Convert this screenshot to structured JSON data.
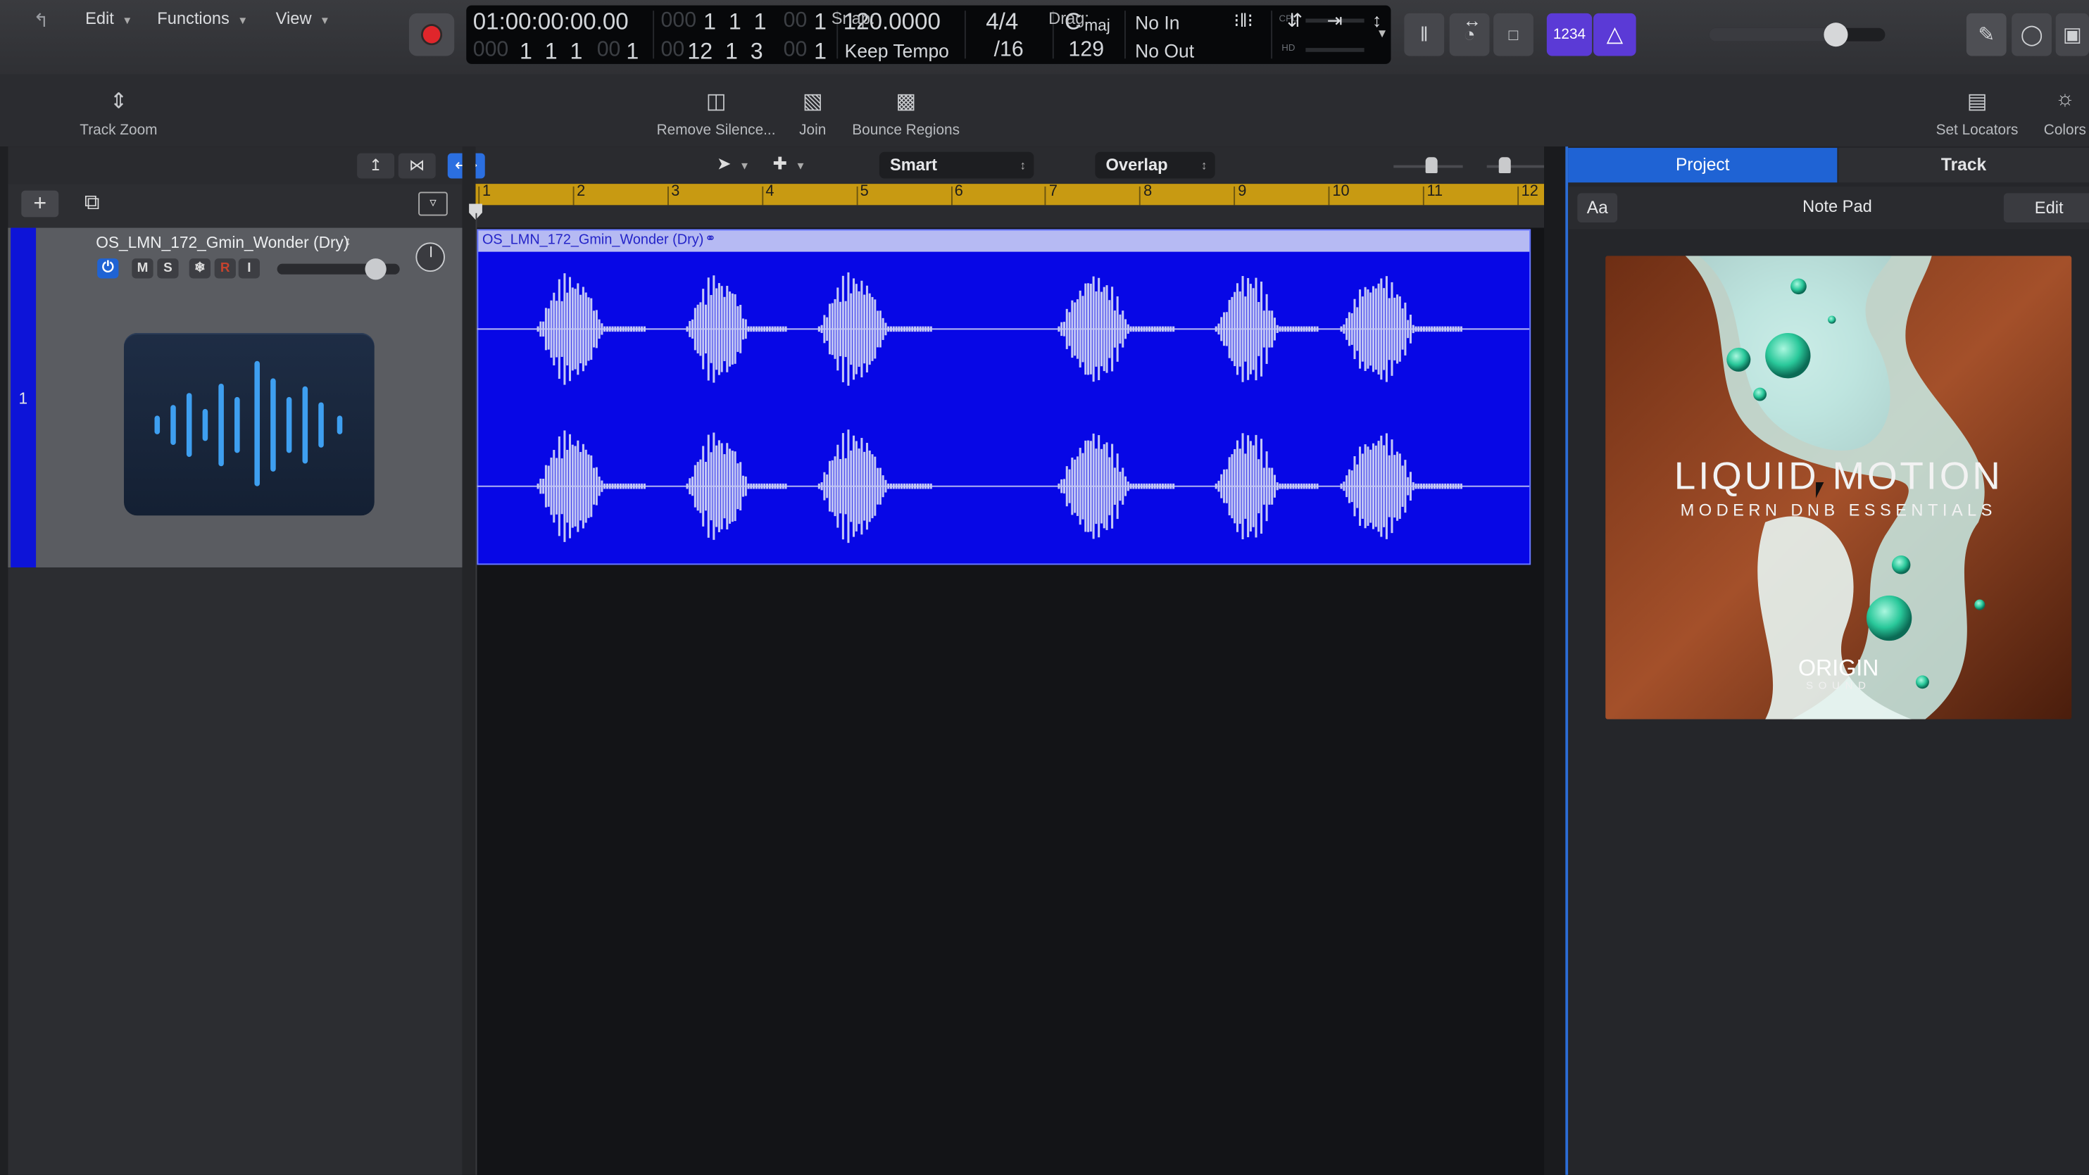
{
  "transport": {
    "position_time": "01:00:00:00.00",
    "position_bars_dim": "000",
    "position_bars": "1  1  1",
    "position_bars_sub_dim": "00",
    "position_bars_sub": "1",
    "pos2_dim": "000",
    "pos2": "1  1  1",
    "pos2_sub_dim": "00",
    "pos2_sub": "1",
    "len_dim": "00",
    "len": "12  1  3",
    "len_sub_dim": "00",
    "len_sub": "1",
    "tempo": "120.0000",
    "tempo_mode": "Keep Tempo",
    "time_sig": "4/4",
    "division": "/16",
    "key": "C",
    "key_mode": "maj",
    "key_value": "129",
    "midi_in": "No In",
    "midi_out": "No Out",
    "cpu_label": "CPU",
    "hd_label": "HD",
    "count_in_label": "1234",
    "master_volume_level": 0.72
  },
  "toolbar": {
    "track_zoom": "Track Zoom",
    "remove_silence": "Remove Silence...",
    "join": "Join",
    "bounce_regions": "Bounce Regions",
    "set_locators": "Set Locators",
    "colors": "Colors"
  },
  "editor_menu": {
    "edit": "Edit",
    "functions": "Functions",
    "view": "View",
    "snap_label": "Snap:",
    "snap_value": "Smart",
    "drag_label": "Drag:",
    "drag_value": "Overlap"
  },
  "track": {
    "number": "1",
    "name": "OS_LMN_172_Gmin_Wonder (Dry)",
    "mute": "M",
    "solo": "S",
    "record": "R",
    "input": "I",
    "volume_level": 0.8
  },
  "ruler": {
    "bars": [
      "1",
      "2",
      "3",
      "4",
      "5",
      "6",
      "7",
      "8",
      "9",
      "10",
      "11",
      "12"
    ]
  },
  "region": {
    "name": "OS_LMN_172_Gmin_Wonder (Dry)"
  },
  "inspector": {
    "tab_project": "Project",
    "tab_track": "Track",
    "font_button": "Aa",
    "title": "Note Pad",
    "edit_button": "Edit",
    "cover_title": "LIQUID MOTION",
    "cover_subtitle": "MODERN DNB ESSENTIALS",
    "cover_brand": "ORIGIN",
    "cover_brand_sub": "SOUND"
  },
  "colors": {
    "region_blue": "#0707e6",
    "waveform": "#c4c8f5",
    "ruler_gold": "#c89a12",
    "accent_blue": "#1f63d4",
    "record_red": "#e0262b"
  }
}
